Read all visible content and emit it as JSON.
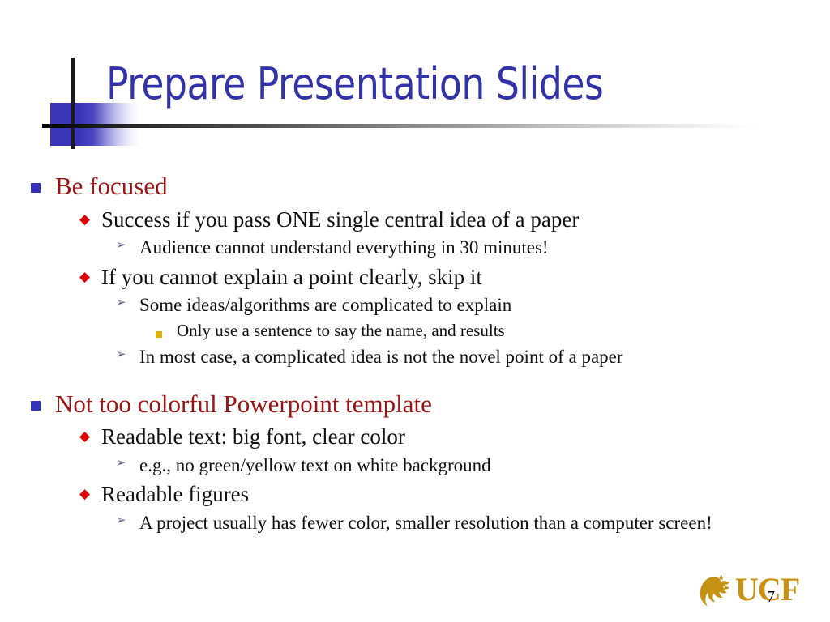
{
  "slide": {
    "title": "Prepare Presentation Slides",
    "title_color": "#3333a8",
    "background_color": "#ffffff",
    "number": "7"
  },
  "decoration": {
    "square_color": "#3a35b5",
    "vertical_line_color": "#1b1b1b",
    "horizontal_rule_from": "#000000",
    "horizontal_rule_to": "#ffffff"
  },
  "bullets": {
    "level1_marker": "■",
    "level1_color": "#3333bb",
    "level1_text_color": "#9c1414",
    "level2_marker": "◆",
    "level2_color": "#dd0000",
    "level3_marker": "➢",
    "level3_color": "#5b6394",
    "level4_marker": "▪",
    "level4_color": "#e0b000",
    "body_text_color": "#111111"
  },
  "outline": [
    {
      "level": 1,
      "text": "Be focused"
    },
    {
      "level": 2,
      "text": "Success if you pass ONE single central idea of a paper"
    },
    {
      "level": 3,
      "text": "Audience cannot understand everything in 30 minutes!"
    },
    {
      "level": 2,
      "text": "If you cannot explain a point clearly, skip it"
    },
    {
      "level": 3,
      "text": "Some ideas/algorithms are complicated to explain"
    },
    {
      "level": 4,
      "text": "Only use a sentence to say the name, and results"
    },
    {
      "level": 3,
      "text": "In most case, a complicated idea is not the novel point of a paper"
    },
    {
      "level": 1,
      "text": "Not too colorful Powerpoint template"
    },
    {
      "level": 2,
      "text": "Readable text: big font, clear color"
    },
    {
      "level": 3,
      "text": "e.g., no green/yellow text on white background"
    },
    {
      "level": 2,
      "text": "Readable figures"
    },
    {
      "level": 3,
      "text": "A project usually has fewer color, smaller resolution than a computer screen!"
    }
  ],
  "logo": {
    "name": "ucf-logo",
    "wordmark": "UCF",
    "mark": "pegasus-icon",
    "color": "#c69214"
  }
}
